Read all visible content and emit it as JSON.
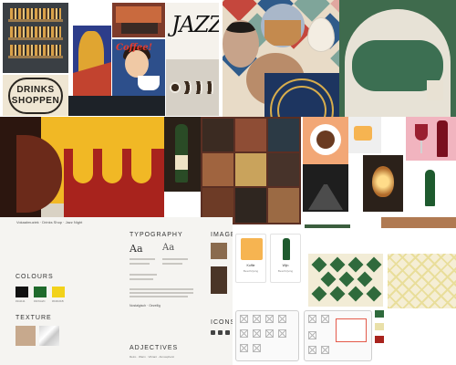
{
  "board": {
    "caption": "Vokaalmuziek · Drinks Shop · Jazz Night",
    "colours_heading": "COLOURS",
    "texture_heading": "TEXTURE",
    "typography_heading": "TYPOGRAPHY",
    "images_heading": "IMAGES",
    "icons_heading": "ICONS",
    "adjectives_heading": "ADJECTIVES",
    "adjectives_words": "Retro · Warm · Vibrant · Atmospheric",
    "type_sample_a": "Aa",
    "type_sample_b": "Aa",
    "body_text": "Nostalgisch · Gezellig"
  },
  "colour_swatches": [
    {
      "hex": "#111111",
      "label": "#111111"
    },
    {
      "hex": "#1f6a2c",
      "label": "#1F6A2C"
    },
    {
      "hex": "#f2d21b",
      "label": "#F2D21B"
    }
  ],
  "photos": {
    "jazz_text": "JAZZ",
    "coffee_text": "Coffee!",
    "drinks_line1": "DRINKS",
    "drinks_line2": "SHOPPEN"
  },
  "ui_mock": {
    "card1_label": "Koffie",
    "card1_sub": "Beschrijving",
    "card2_label": "Wijn",
    "card2_sub": "Beschrijving"
  },
  "accent_colors": {
    "mustard": "#f1b825",
    "deep_red": "#a8231d",
    "bottle_green": "#1e5a2e",
    "navy": "#1d3560",
    "gold": "#d8ad4c"
  }
}
